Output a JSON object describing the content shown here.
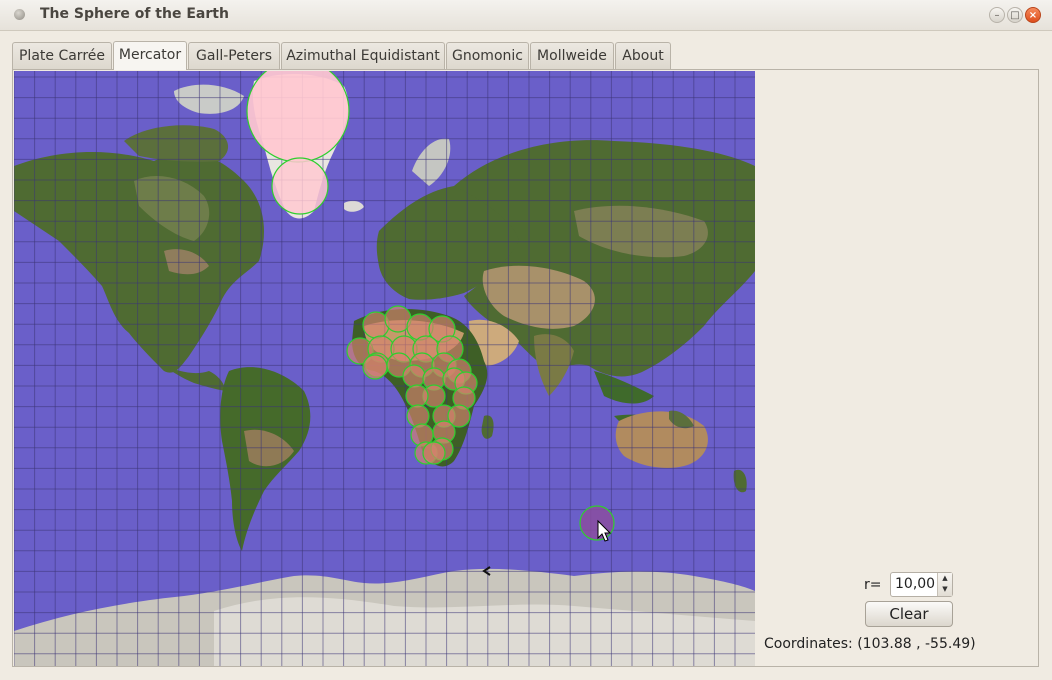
{
  "window": {
    "title": "The Sphere of the Earth",
    "minimize": "–",
    "maximize": "□",
    "close": "×"
  },
  "tabs": [
    {
      "label": "Plate Carrée"
    },
    {
      "label": "Mercator"
    },
    {
      "label": "Gall-Peters"
    },
    {
      "label": "Azimuthal Equidistant"
    },
    {
      "label": "Gnomonic"
    },
    {
      "label": "Mollweide"
    },
    {
      "label": "About"
    }
  ],
  "active_tab": "Mercator",
  "controls": {
    "radius_label": "r=",
    "radius_value": "10,00",
    "clear_label": "Clear",
    "coordinates": "Coordinates: (103.88 , -55.49)"
  },
  "colors": {
    "ocean": "#6a5fc9",
    "grid": "#3c3577",
    "circle_outline": "#2ecf2e",
    "greenland_fill": "#ffc8d0",
    "africa_fill": "#d7826e",
    "ocean_circle_fill": "#8a4ea0"
  },
  "icons": {
    "cursor": "arrow-cursor-icon",
    "spin_up": "chevron-up-icon",
    "spin_down": "chevron-down-icon"
  }
}
